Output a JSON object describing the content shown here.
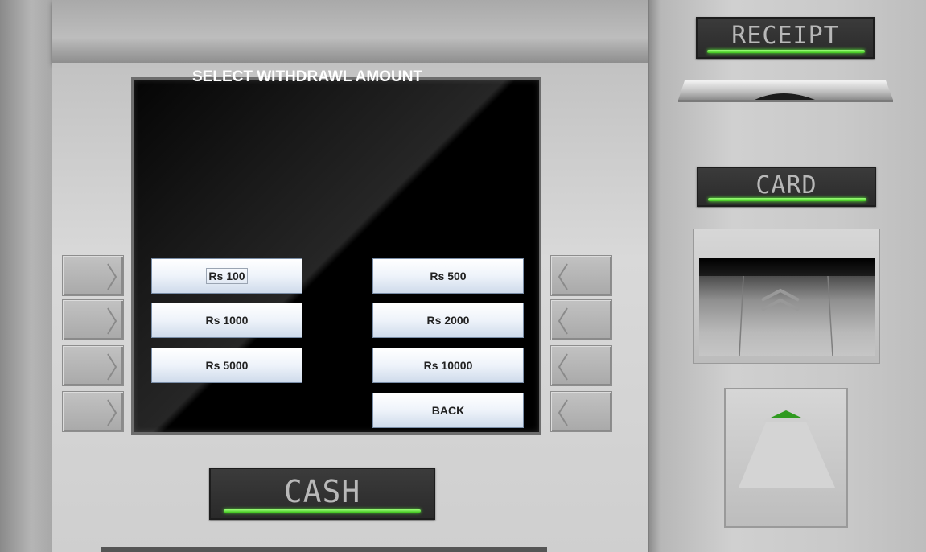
{
  "screen": {
    "title": "SELECT WITHDRAWL AMOUNT",
    "amounts": {
      "rs100": "Rs 100",
      "rs500": "Rs 500",
      "rs1000": "Rs 1000",
      "rs2000": "Rs 2000",
      "rs5000": "Rs 5000",
      "rs10000": "Rs 10000",
      "back": "BACK"
    }
  },
  "labels": {
    "receipt": "RECEIPT",
    "card": "CARD",
    "cash": "CASH"
  },
  "colors": {
    "led": "#4cd62a",
    "screen_bg": "#000000",
    "button_bg": "#e6eef8"
  },
  "icons": {
    "left_keys": "chevron-right-icon",
    "right_keys": "chevron-left-icon",
    "card_arrow": "double-chevron-up-icon"
  }
}
